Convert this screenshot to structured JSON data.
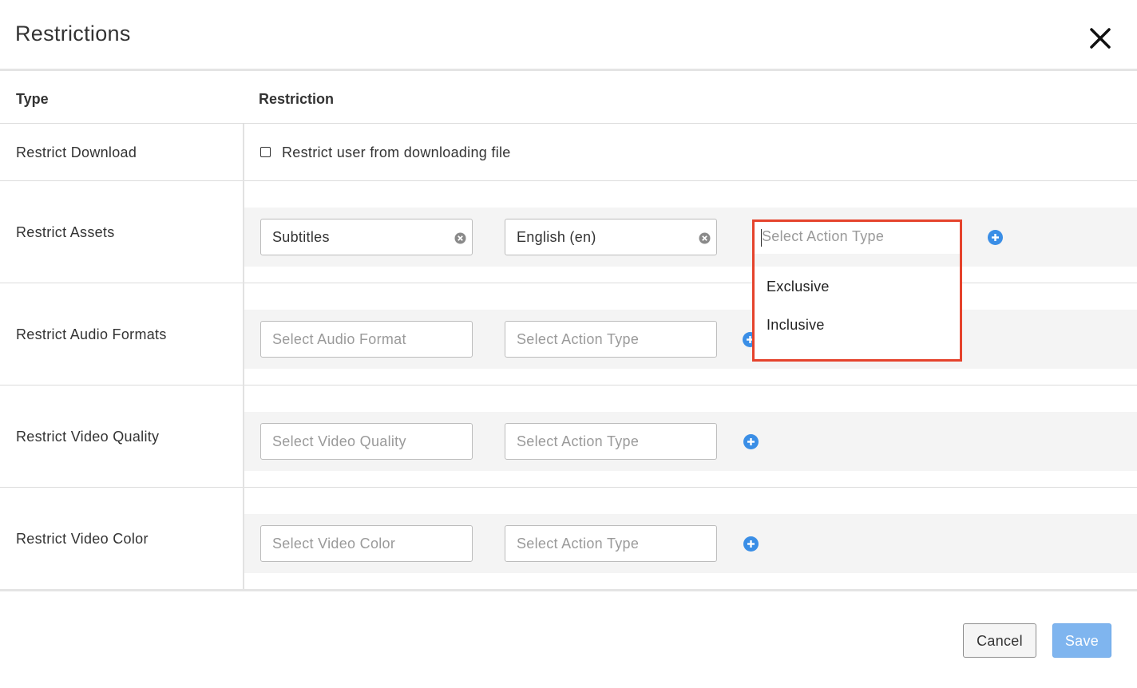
{
  "dialog": {
    "title": "Restrictions"
  },
  "table": {
    "headers": {
      "type": "Type",
      "restriction": "Restriction"
    },
    "download": {
      "label": "Restrict Download",
      "checkbox_label": "Restrict user from downloading file",
      "checked": false
    },
    "assets": {
      "label": "Restrict Assets",
      "field1_value": "Subtitles",
      "field2_value": "English (en)",
      "action_placeholder": "Select Action Type"
    },
    "audio": {
      "label": "Restrict Audio Formats",
      "field1_placeholder": "Select Audio Format",
      "field2_placeholder": "Select Action Type"
    },
    "video_quality": {
      "label": "Restrict Video Quality",
      "field1_placeholder": "Select Video Quality",
      "field2_placeholder": "Select Action Type"
    },
    "video_color": {
      "label": "Restrict Video Color",
      "field1_placeholder": "Select Video Color",
      "field2_placeholder": "Select Action Type"
    }
  },
  "dropdown": {
    "options": [
      "Exclusive",
      "Inclusive"
    ]
  },
  "footer": {
    "cancel_label": "Cancel",
    "save_label": "Save"
  },
  "colors": {
    "accent_blue": "#3a8ee6",
    "highlight_red": "#e5432c",
    "save_disabled": "#7fb5ef"
  }
}
